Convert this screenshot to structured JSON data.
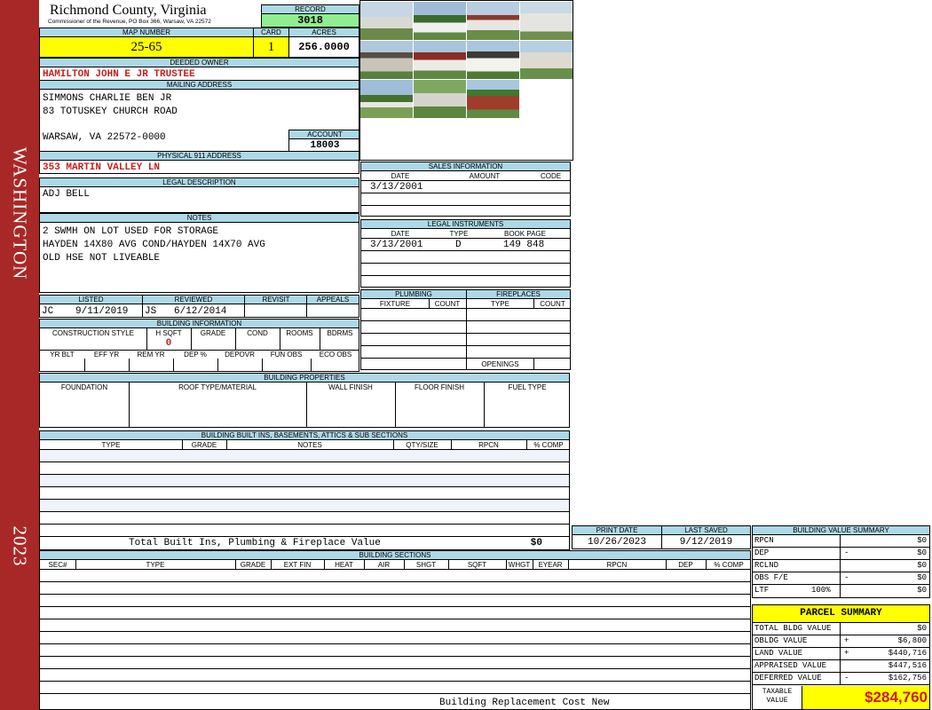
{
  "county": "Richmond County, Virginia",
  "commissioner": "Commissioner of the Revenue, PO Box 366, Warsaw, VA 22572",
  "sidebar": {
    "district": "WASHINGTON",
    "year": "2023"
  },
  "colors": {
    "sidebar": "#a82828",
    "header_blue": "#add8e6",
    "record_green": "#90ee90",
    "highlight_yellow": "#ffff00",
    "value_red": "#c81e1e"
  },
  "record": {
    "label": "RECORD",
    "value": "3018"
  },
  "map_number": {
    "label": "MAP NUMBER",
    "value": "25-65"
  },
  "card": {
    "label": "CARD",
    "value": "1"
  },
  "acres": {
    "label": "ACRES",
    "value": "256.0000"
  },
  "deeded_owner": {
    "label": "DEEDED OWNER",
    "value": "HAMILTON JOHN E JR TRUSTEE"
  },
  "mailing": {
    "label": "MAILING ADDRESS",
    "line1": "SIMMONS CHARLIE BEN JR",
    "line2": "83 TOTUSKEY CHURCH ROAD",
    "line3": "WARSAW, VA 22572-0000"
  },
  "account": {
    "label": "ACCOUNT",
    "value": "18003"
  },
  "physical": {
    "label": "PHYSICAL 911 ADDRESS",
    "value": "353 MARTIN VALLEY LN"
  },
  "legal": {
    "label": "LEGAL DESCRIPTION",
    "value": "ADJ BELL"
  },
  "notes": {
    "label": "NOTES",
    "line1": "2 SWMH ON LOT USED FOR STORAGE",
    "line2": "HAYDEN 14X80 AVG COND/HAYDEN 14X70 AVG",
    "line3": "OLD HSE NOT LIVEABLE"
  },
  "listed": {
    "label": "LISTED",
    "by": "JC",
    "date": "9/11/2019"
  },
  "reviewed": {
    "label": "REVIEWED",
    "by": "JS",
    "date": "6/12/2014"
  },
  "revisit": {
    "label": "REVISIT"
  },
  "appeals": {
    "label": "APPEALS"
  },
  "building_info": {
    "label": "BUILDING INFORMATION",
    "cols1": [
      "CONSTRUCTION STYLE",
      "H SQFT",
      "GRADE",
      "COND",
      "ROOMS",
      "BDRMS"
    ],
    "hsqft": "0",
    "cols2": [
      "YR BLT",
      "EFF YR",
      "REM YR",
      "DEP %",
      "DEPOVR",
      "FUN OBS",
      "ECO OBS"
    ]
  },
  "sales": {
    "label": "SALES INFORMATION",
    "cols": [
      "DATE",
      "AMOUNT",
      "CODE"
    ],
    "date": "3/13/2001"
  },
  "legal_instruments": {
    "label": "LEGAL INSTRUMENTS",
    "cols": [
      "DATE",
      "TYPE",
      "BOOK PAGE"
    ],
    "date": "3/13/2001",
    "type": "D",
    "book_page": "149 848"
  },
  "plumbing": {
    "label": "PLUMBING",
    "cols": [
      "FIXTURE",
      "COUNT"
    ]
  },
  "fireplaces": {
    "label": "FIREPLACES",
    "cols": [
      "TYPE",
      "COUNT"
    ],
    "openings": "OPENINGS"
  },
  "building_properties": {
    "label": "BUILDING PROPERTIES",
    "cols": [
      "FOUNDATION",
      "ROOF TYPE/MATERIAL",
      "WALL FINISH",
      "FLOOR FINISH",
      "FUEL TYPE"
    ]
  },
  "built_ins": {
    "label": "BUILDING BUILT INS, BASEMENTS, ATTICS & SUB SECTIONS",
    "cols": [
      "TYPE",
      "GRADE",
      "NOTES",
      "QTY/SIZE",
      "RPCN",
      "% COMP"
    ]
  },
  "total_built_ins": {
    "label": "Total Built Ins, Plumbing & Fireplace Value",
    "value": "$0"
  },
  "print_date": {
    "label": "PRINT DATE",
    "value": "10/26/2023"
  },
  "last_saved": {
    "label": "LAST SAVED",
    "value": "9/12/2019"
  },
  "building_sections": {
    "label": "BUILDING SECTIONS",
    "cols": [
      "SEC#",
      "TYPE",
      "GRADE",
      "EXT FIN",
      "HEAT",
      "AIR",
      "SHGT",
      "SQFT",
      "WHGT",
      "EYEAR",
      "RPCN",
      "DEP",
      "% COMP"
    ]
  },
  "replacement_cost": "Building Replacement Cost New",
  "value_summary": {
    "label": "BUILDING VALUE SUMMARY",
    "rows": [
      {
        "label": "RPCN",
        "sign": "",
        "value": "$0"
      },
      {
        "label": "DEP",
        "sign": "-",
        "value": "$0"
      },
      {
        "label": "RCLND",
        "sign": "",
        "value": "$0"
      },
      {
        "label": "OBS F/E",
        "sign": "-",
        "value": "$0"
      },
      {
        "label": "LTF",
        "pct": "100%",
        "sign": "",
        "value": "$0"
      }
    ]
  },
  "parcel_summary": {
    "label": "PARCEL SUMMARY",
    "rows": [
      {
        "label": "TOTAL BLDG VALUE",
        "sign": "",
        "value": "$0"
      },
      {
        "label": "OBLDG VALUE",
        "sign": "+",
        "value": "$6,800"
      },
      {
        "label": "LAND VALUE",
        "sign": "+",
        "value": "$440,716"
      },
      {
        "label": "APPRAISED VALUE",
        "sign": "",
        "value": "$447,516"
      },
      {
        "label": "DEFERRED VALUE",
        "sign": "-",
        "value": "$162,756"
      }
    ],
    "taxable_label1": "TAXABLE",
    "taxable_label2": "VALUE",
    "taxable_value": "$284,760"
  }
}
